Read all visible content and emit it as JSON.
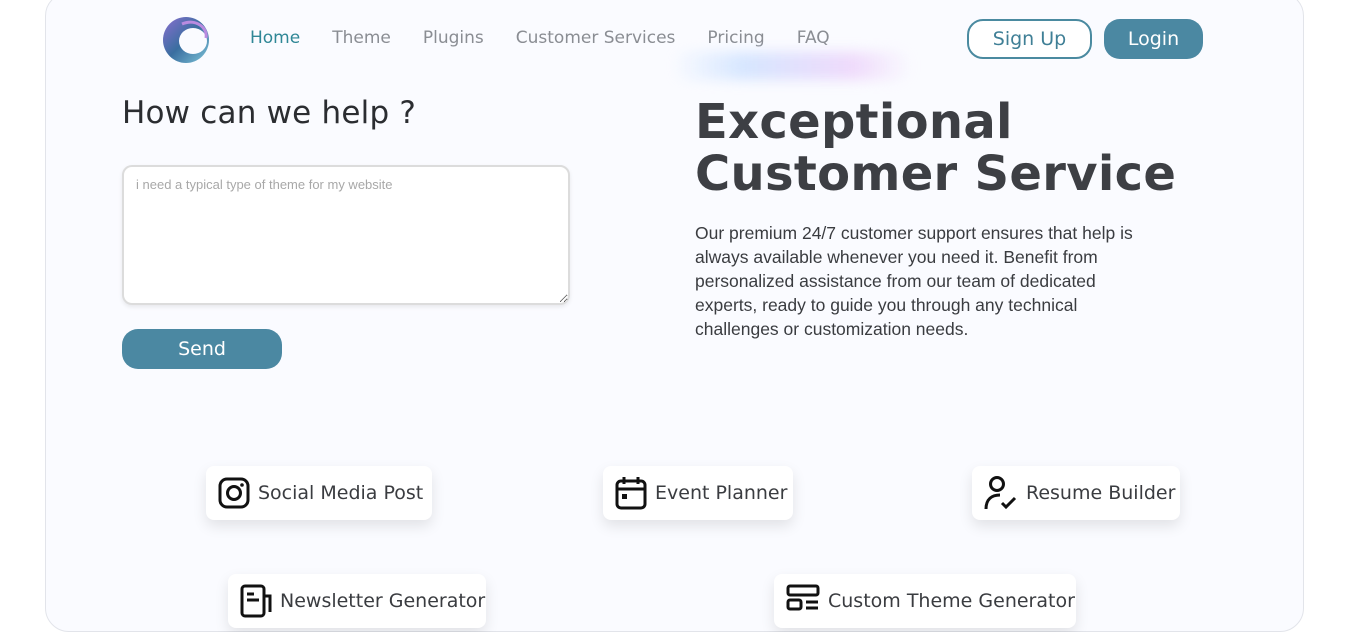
{
  "nav": {
    "items": [
      {
        "label": "Home",
        "active": true
      },
      {
        "label": "Theme"
      },
      {
        "label": "Plugins"
      },
      {
        "label": "Customer Services"
      },
      {
        "label": "Pricing"
      },
      {
        "label": "FAQ"
      }
    ],
    "signup_label": "Sign Up",
    "login_label": "Login"
  },
  "help": {
    "title": "How can we help ?",
    "placeholder": "i need a typical type of theme for my website",
    "send_label": "Send"
  },
  "hero": {
    "title_line1": "Exceptional",
    "title_line2": "Customer Service",
    "description": "Our premium 24/7 customer support ensures that help is always available whenever you need it. Benefit from personalized assistance from our team of dedicated experts, ready to guide you through any technical challenges or customization needs."
  },
  "tools": [
    {
      "label": "Social Media Post",
      "icon": "instagram-icon"
    },
    {
      "label": "Event Planner",
      "icon": "calendar-icon"
    },
    {
      "label": "Resume Builder",
      "icon": "user-check-icon"
    },
    {
      "label": "Newsletter Generator",
      "icon": "newspaper-icon"
    },
    {
      "label": "Custom Theme Generator",
      "icon": "layout-icon"
    }
  ],
  "colors": {
    "accent": "#4b88a2",
    "nav_active": "#2f8796",
    "page_bg": "#fafbff"
  }
}
